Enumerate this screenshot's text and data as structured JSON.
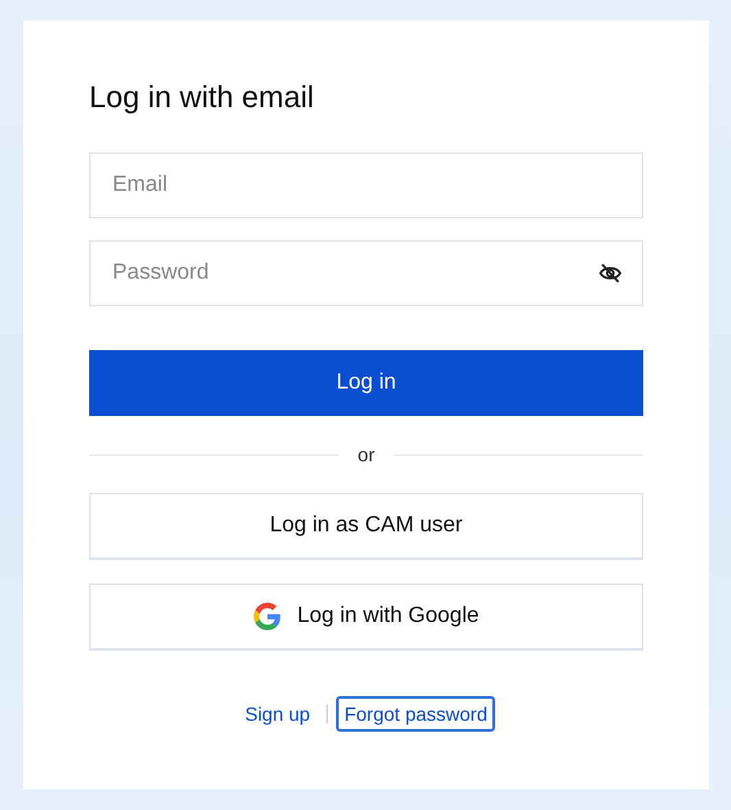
{
  "title": "Log in with email",
  "email": {
    "placeholder": "Email"
  },
  "password": {
    "placeholder": "Password"
  },
  "login_button": "Log in",
  "divider": "or",
  "alt_buttons": [
    {
      "kind": "plain",
      "label": "Log in as CAM user"
    },
    {
      "kind": "google",
      "label": "Log in with Google"
    }
  ],
  "links": [
    {
      "label": "Sign up",
      "focused": false
    },
    {
      "label": "Forgot password",
      "focused": true
    }
  ]
}
